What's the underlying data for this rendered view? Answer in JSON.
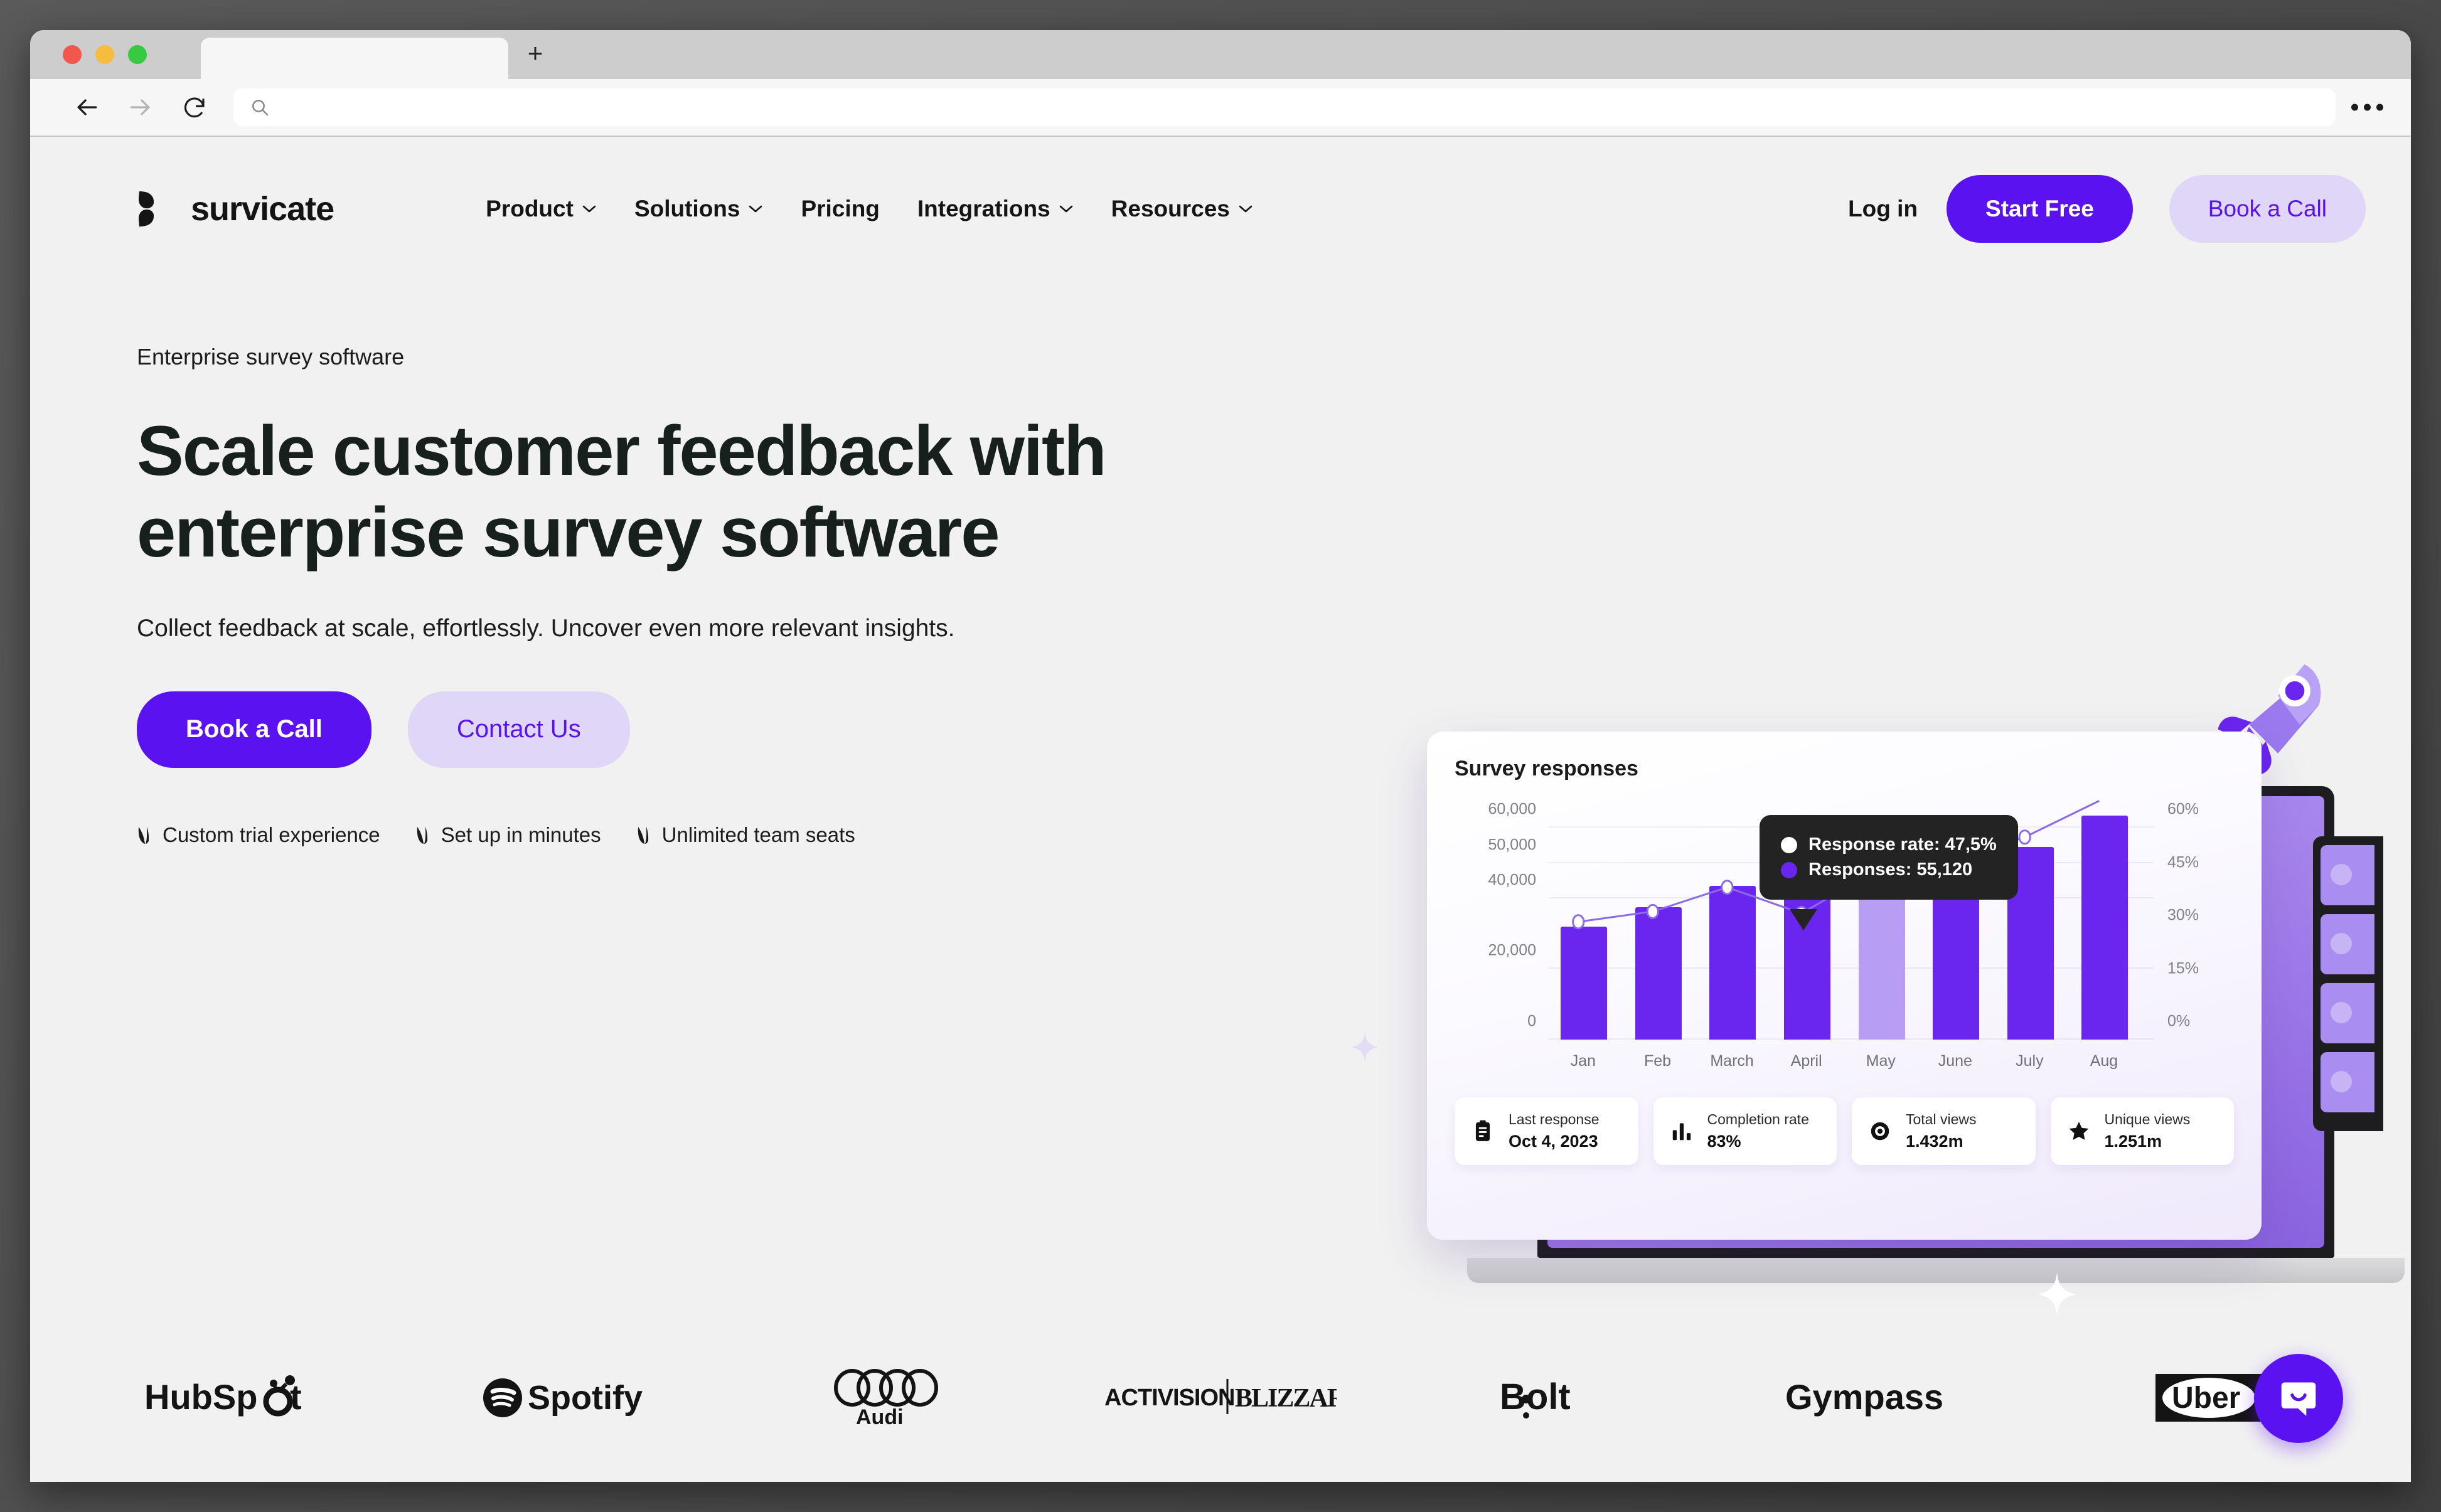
{
  "browser": {
    "tab_title": "",
    "url_value": "",
    "url_placeholder": "",
    "back_icon": "back-arrow-icon",
    "forward_icon": "forward-arrow-icon",
    "reload_icon": "reload-icon",
    "search_icon": "search-icon",
    "new_tab_label": "+",
    "overflow_label": "..."
  },
  "site": {
    "logo_text": "survicate",
    "menu": [
      {
        "label": "Product",
        "has_chevron": true
      },
      {
        "label": "Solutions",
        "has_chevron": true
      },
      {
        "label": "Pricing",
        "has_chevron": false
      },
      {
        "label": "Integrations",
        "has_chevron": true
      },
      {
        "label": "Resources",
        "has_chevron": true
      }
    ],
    "login_label": "Log in",
    "start_free_label": "Start Free",
    "book_call_label": "Book a Call"
  },
  "hero": {
    "eyebrow": "Enterprise survey software",
    "headline": "Scale customer feedback with enterprise survey software",
    "subhead": "Collect feedback at scale, effortlessly. Uncover even more relevant insights.",
    "primary_cta": "Book a Call",
    "secondary_cta": "Contact Us",
    "bullets": [
      "Custom trial experience",
      "Set up in minutes",
      "Unlimited team seats"
    ]
  },
  "dashboard": {
    "card_title": "Survey responses",
    "tooltip": {
      "rows": [
        {
          "label": "Response rate: 47,5%",
          "color": "#ffffff"
        },
        {
          "label": "Responses: 55,120",
          "color": "#6a26ee"
        }
      ]
    },
    "stats": [
      {
        "icon": "clipboard-icon",
        "label": "Last response",
        "value": "Oct 4, 2023"
      },
      {
        "icon": "bar-chart-icon",
        "label": "Completion rate",
        "value": "83%"
      },
      {
        "icon": "eye-icon",
        "label": "Total views",
        "value": "1.432m"
      },
      {
        "icon": "star-icon",
        "label": "Unique views",
        "value": "1.251m"
      }
    ]
  },
  "chart_data": {
    "type": "bar",
    "title": "Survey responses",
    "categories": [
      "Jan",
      "Feb",
      "March",
      "April",
      "May",
      "June",
      "July",
      "Aug"
    ],
    "series": [
      {
        "name": "Responses",
        "type": "bar",
        "values": [
          32000,
          37500,
          43500,
          46500,
          55120,
          51500,
          54500,
          63500
        ],
        "highlight_index": 4,
        "color": "#6a26ee",
        "highlight_color": "#b79df4"
      },
      {
        "name": "Response rate",
        "type": "line",
        "values": [
          32.5,
          35.5,
          42.5,
          35.0,
          47.5,
          50.5,
          57.0,
          75.0
        ],
        "color": "#8c6ae6"
      }
    ],
    "ylabel": "",
    "ytick_labels": [
      "0",
      "20,000",
      "40,000",
      "50,000",
      "60,000"
    ],
    "ytick_values": [
      0,
      20000,
      40000,
      50000,
      60000
    ],
    "ylim": [
      0,
      70000
    ],
    "y2tick_labels": [
      "0%",
      "15%",
      "30%",
      "45%",
      "60%"
    ],
    "y2tick_values": [
      0,
      15,
      30,
      45,
      60
    ],
    "y2lim": [
      0,
      70
    ],
    "xlabel": "",
    "grid": true,
    "legend": "tooltip"
  },
  "brands": [
    {
      "name": "HubSpot"
    },
    {
      "name": "Spotify"
    },
    {
      "name": "Audi"
    },
    {
      "name": "Activision Blizzard"
    },
    {
      "name": "Bolt"
    },
    {
      "name": "Gympass"
    },
    {
      "name": "Uber"
    }
  ],
  "chat": {
    "icon": "chat-bubble-icon"
  },
  "colors": {
    "brand_purple": "#5a13f0",
    "soft_purple": "#e0d6f7",
    "bar_purple": "#6a26ee",
    "bar_highlight": "#b79df4",
    "page_bg": "#f1f1f1",
    "ink": "#17201c",
    "cursor_teal": "#4fd1b0"
  }
}
